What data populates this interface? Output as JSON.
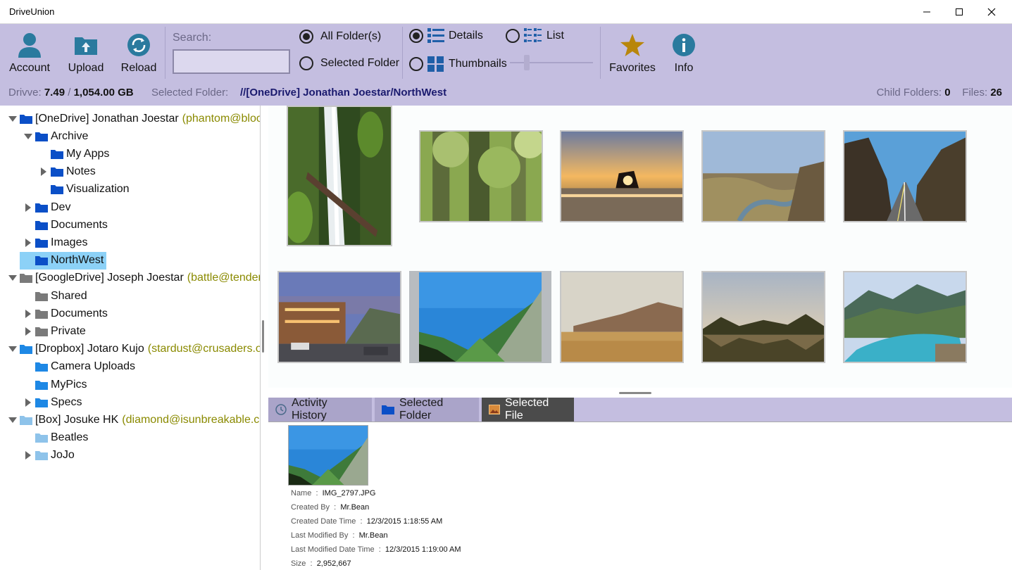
{
  "window": {
    "title": "DriveUnion"
  },
  "toolbar": {
    "account_label": "Account",
    "upload_label": "Upload",
    "reload_label": "Reload",
    "search_label": "Search:",
    "search_value": "",
    "scope_all": "All Folder(s)",
    "scope_selected": "Selected Folder",
    "scope_value": "all",
    "view_details": "Details",
    "view_list": "List",
    "view_thumbnails": "Thumbnails",
    "view_value": "details",
    "favorites_label": "Favorites",
    "info_label": "Info",
    "colors": {
      "bg": "#c4bee0",
      "icon_blue": "#2a7a9e",
      "star": "#b8860b"
    }
  },
  "status": {
    "drive_label": "Drivve:",
    "drive_used": "7.49",
    "drive_sep": "/",
    "drive_total": "1,054.00 GB",
    "selected_label": "Selected Folder:",
    "selected_path": "//[OneDrive] Jonathan Joestar/NorthWest",
    "child_label": "Child Folders:",
    "child_count": "0",
    "files_label": "Files:",
    "files_count": "26"
  },
  "tree": [
    {
      "label": "[OneDrive] Jonathan Joestar",
      "account": "(phantom@bloo",
      "level": 0,
      "expander": "open",
      "color": "#0b4fc7"
    },
    {
      "label": "Archive",
      "level": 1,
      "expander": "open",
      "color": "#0b4fc7"
    },
    {
      "label": "My Apps",
      "level": 2,
      "expander": "none",
      "color": "#0b4fc7"
    },
    {
      "label": "Notes",
      "level": 2,
      "expander": "closed",
      "color": "#0b4fc7"
    },
    {
      "label": "Visualization",
      "level": 2,
      "expander": "none",
      "color": "#0b4fc7"
    },
    {
      "label": "Dev",
      "level": 1,
      "expander": "closed",
      "color": "#0b4fc7"
    },
    {
      "label": "Documents",
      "level": 1,
      "expander": "none",
      "color": "#0b4fc7"
    },
    {
      "label": "Images",
      "level": 1,
      "expander": "closed",
      "color": "#0b4fc7"
    },
    {
      "label": "NorthWest",
      "level": 1,
      "expander": "none",
      "color": "#0b4fc7",
      "selected": true
    },
    {
      "label": "[GoogleDrive] Joseph Joestar",
      "account": "(battle@tenden",
      "level": 0,
      "expander": "open",
      "color": "#7a7a7a"
    },
    {
      "label": "Shared",
      "level": 1,
      "expander": "none",
      "color": "#7a7a7a"
    },
    {
      "label": "Documents",
      "level": 1,
      "expander": "closed",
      "color": "#7a7a7a"
    },
    {
      "label": "Private",
      "level": 1,
      "expander": "closed",
      "color": "#7a7a7a"
    },
    {
      "label": "[Dropbox] Jotaro Kujo",
      "account": "(stardust@crusaders.o",
      "level": 0,
      "expander": "open",
      "color": "#1e88e5"
    },
    {
      "label": "Camera Uploads",
      "level": 1,
      "expander": "none",
      "color": "#1e88e5"
    },
    {
      "label": "MyPics",
      "level": 1,
      "expander": "none",
      "color": "#1e88e5"
    },
    {
      "label": "Specs",
      "level": 1,
      "expander": "closed",
      "color": "#1e88e5"
    },
    {
      "label": "[Box] Josuke HK",
      "account": "(diamond@isunbreakable.co",
      "level": 0,
      "expander": "open",
      "color": "#8ec3ea"
    },
    {
      "label": "Beatles",
      "level": 1,
      "expander": "none",
      "color": "#8ec3ea"
    },
    {
      "label": "JoJo",
      "level": 1,
      "expander": "closed",
      "color": "#8ec3ea"
    }
  ],
  "gallery": [
    {
      "name": "waterfall-thumb",
      "kind": "waterfall"
    },
    {
      "name": "forest-thumb",
      "kind": "forest"
    },
    {
      "name": "sunset-rock-thumb",
      "kind": "sunset"
    },
    {
      "name": "river-valley-thumb",
      "kind": "river"
    },
    {
      "name": "canyon-road-thumb",
      "kind": "road"
    },
    {
      "name": "village-street-thumb",
      "kind": "village"
    },
    {
      "name": "mountain-valley-thumb",
      "kind": "valley",
      "active": true
    },
    {
      "name": "desert-cliff-thumb",
      "kind": "desert"
    },
    {
      "name": "lake-reflection-thumb",
      "kind": "lake"
    },
    {
      "name": "mountain-lake-thumb",
      "kind": "mountainlake"
    }
  ],
  "tabs": [
    {
      "label": "Activity History",
      "icon": "clock-icon",
      "state": "inactive"
    },
    {
      "label": "Selected Folder",
      "icon": "folder-icon",
      "state": "inactive"
    },
    {
      "label": "Selected File",
      "icon": "image-icon",
      "state": "active"
    }
  ],
  "details": [
    {
      "label": "Name",
      "value": "IMG_2797.JPG"
    },
    {
      "label": "Created By",
      "value": "Mr.Bean"
    },
    {
      "label": "Created Date Time",
      "value": "12/3/2015 1:18:55 AM"
    },
    {
      "label": "Last Modified By",
      "value": "Mr.Bean"
    },
    {
      "label": "Last Modified Date Time",
      "value": "12/3/2015 1:19:00 AM"
    },
    {
      "label": "Size",
      "value": "2,952,667"
    }
  ]
}
